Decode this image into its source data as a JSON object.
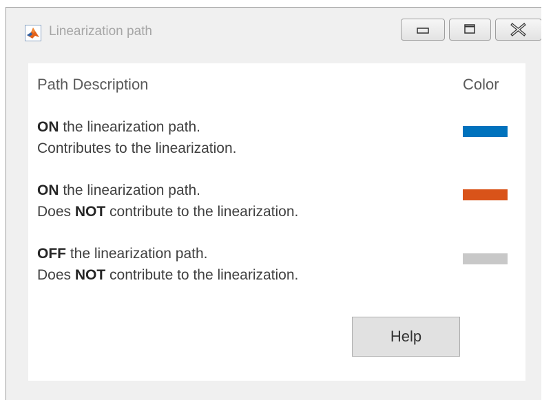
{
  "window": {
    "title": "Linearization path",
    "app_icon": "matlab-logo-icon",
    "controls": {
      "minimize_icon": "minimize-icon",
      "maximize_icon": "maximize-icon",
      "close_icon": "close-icon"
    }
  },
  "table": {
    "header_description": "Path Description",
    "header_color": "Color",
    "rows": [
      {
        "line1_bold": "ON",
        "line1_rest": " the linearization path.",
        "line2_pre": "Contributes to the linearization.",
        "line2_bold": "",
        "line2_rest": "",
        "color": "#0072bd"
      },
      {
        "line1_bold": "ON",
        "line1_rest": " the linearization path.",
        "line2_pre": "Does ",
        "line2_bold": "NOT",
        "line2_rest": " contribute to the linearization.",
        "color": "#d95319"
      },
      {
        "line1_bold": "OFF",
        "line1_rest": " the linearization path.",
        "line2_pre": "Does ",
        "line2_bold": "NOT",
        "line2_rest": " contribute to the linearization.",
        "color": "#c8c8c8"
      }
    ]
  },
  "help_button": {
    "label": "Help"
  }
}
